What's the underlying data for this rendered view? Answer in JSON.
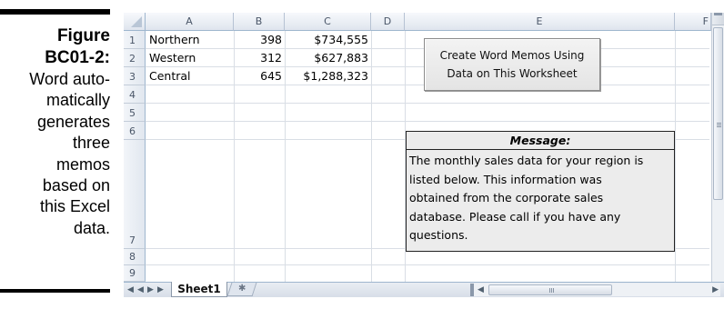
{
  "caption": {
    "figure_label": "Figure",
    "figure_number": "BC01-2:",
    "lines": [
      "Word auto-",
      "matically",
      "generates",
      "three",
      "memos",
      "based on",
      "this Excel",
      "data."
    ]
  },
  "sheet": {
    "columns": [
      "A",
      "B",
      "C",
      "D",
      "E",
      "F"
    ],
    "rows": [
      "1",
      "2",
      "3",
      "4",
      "5",
      "6",
      "7",
      "8",
      "9"
    ],
    "data": [
      {
        "region": "Northern",
        "count": "398",
        "sales": "$734,555"
      },
      {
        "region": "Western",
        "count": "312",
        "sales": "$627,883"
      },
      {
        "region": "Central",
        "count": "645",
        "sales": "$1,288,323"
      }
    ],
    "button_lines": [
      "Create Word Memos Using",
      "Data on This Worksheet"
    ],
    "message_title": "Message:",
    "message_lines": [
      "The monthly sales data for your region is",
      "listed below. This information was",
      "obtained from the corporate sales",
      "database. Please call if you have any",
      "questions."
    ],
    "tab_name": "Sheet1",
    "nav": {
      "first": "◀",
      "prev": "◀",
      "next": "▶",
      "last": "▶"
    }
  }
}
